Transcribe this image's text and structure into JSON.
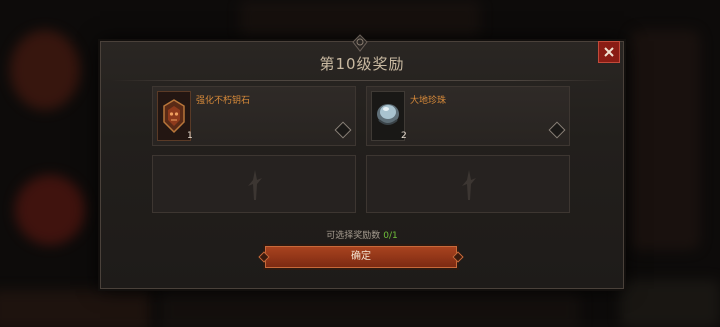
{
  "dialog": {
    "title": "第10级奖励",
    "close_label": "✕",
    "rewards": [
      {
        "name": "强化不朽钥石",
        "count": "1",
        "icon": "keystone-icon"
      },
      {
        "name": "大地珍珠",
        "count": "2",
        "icon": "pearl-icon"
      }
    ],
    "empty_slot_icon": "dagger-placeholder-icon",
    "counter_label": "可选择奖励数",
    "counter_value": "0/1",
    "confirm_label": "确定"
  },
  "colors": {
    "accent": "#d98b3a",
    "counter_value": "#6fbf3a",
    "button": "#9a3a1a",
    "close": "#8a1c14"
  }
}
